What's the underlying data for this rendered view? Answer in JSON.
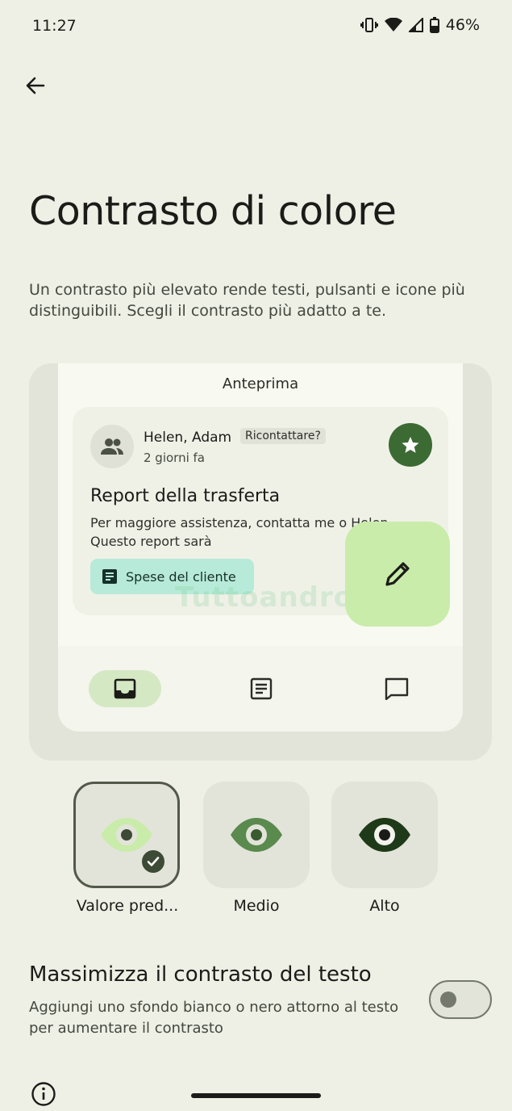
{
  "status_bar": {
    "time": "11:27",
    "battery": "46%"
  },
  "page": {
    "title": "Contrasto di colore",
    "description": "Un contrasto più elevato rende testi, pulsanti e icone più distinguibili. Scegli il contrasto più adatto a te."
  },
  "preview": {
    "label": "Anteprima",
    "sender": "Helen, Adam",
    "chip": "Ricontattare?",
    "time_ago": "2 giorni fa",
    "subject": "Report della trasferta",
    "body": "Per maggiore assistenza, contatta me o Helen.\nQuesto report sarà",
    "attachment": "Spese del cliente",
    "watermark": "Tuttoandroid"
  },
  "contrast_options": [
    {
      "label": "Valore pred...",
      "selected": true
    },
    {
      "label": "Medio",
      "selected": false
    },
    {
      "label": "Alto",
      "selected": false
    }
  ],
  "maximize": {
    "title": "Massimizza il contrasto del testo",
    "description": "Aggiungi uno sfondo bianco o nero attorno al testo per aumentare il contrasto",
    "enabled": false
  },
  "colors": {
    "background": "#eef0e6",
    "accent_dark": "#3c6a33",
    "fab": "#c9ecaa",
    "attachment": "#b7ead8"
  }
}
